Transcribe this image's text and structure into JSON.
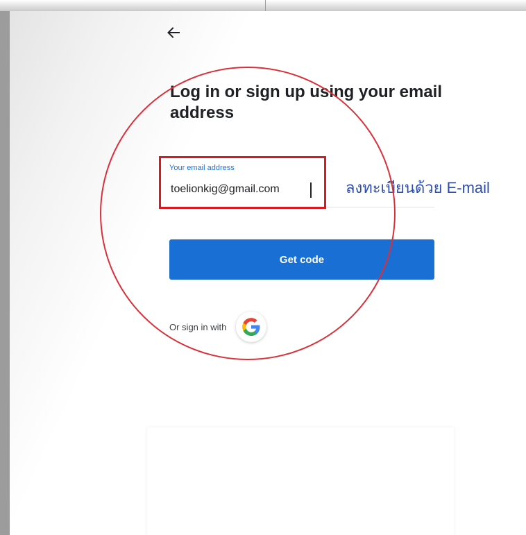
{
  "header": {
    "back_icon": "arrow-left-icon",
    "title": "Log in or sign up using your email address"
  },
  "email": {
    "label": "Your email address",
    "value": "toelionkig@gmail.com"
  },
  "annotation": {
    "text": "ลงทะเบียนด้วย  E-mail"
  },
  "actions": {
    "get_code_label": "Get code",
    "alt_sign_in_label": "Or sign in with",
    "google_icon": "google-icon"
  },
  "colors": {
    "primary": "#1a6fd4",
    "label_blue": "#1a73e8",
    "highlight_red": "#d81a22",
    "annotation_blue": "#2d4fb0"
  }
}
